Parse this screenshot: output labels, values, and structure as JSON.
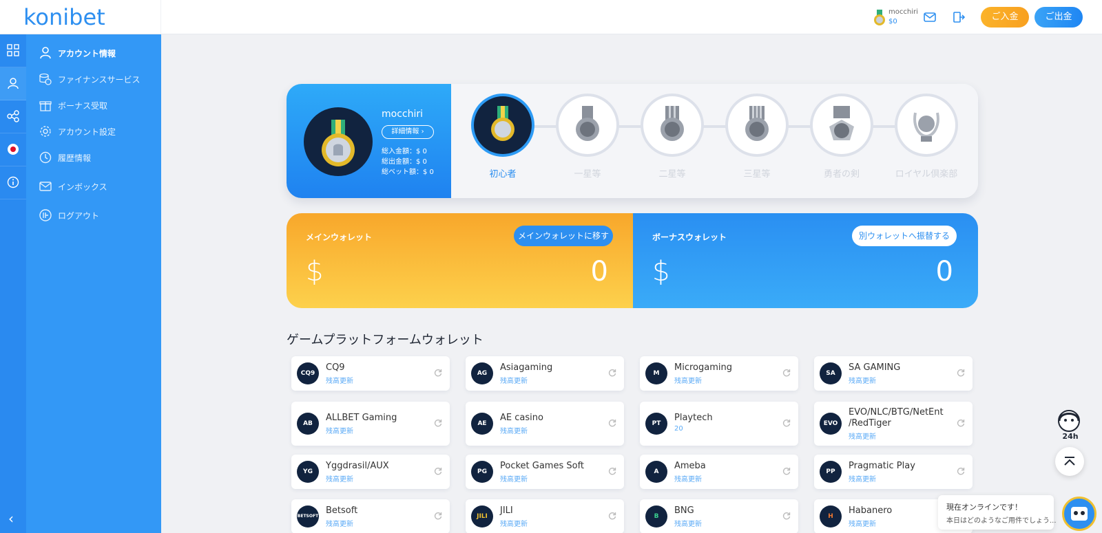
{
  "header": {
    "logo": "konibet",
    "username": "mocchiri",
    "balance": "$0",
    "deposit_label": "ご入金",
    "withdraw_label": "ご出金",
    "accent": "#2d8ff0"
  },
  "rail": {
    "icons": [
      "grid-icon",
      "user-icon",
      "share-icon",
      "flag-icon",
      "info-icon"
    ],
    "collapse": "‹"
  },
  "sidebar": {
    "items": [
      {
        "label": "アカウント情報",
        "icon": "user-icon"
      },
      {
        "label": "ファイナンスサービス",
        "icon": "finance-icon"
      },
      {
        "label": "ボーナス受取",
        "icon": "gift-icon"
      },
      {
        "label": "アカウント設定",
        "icon": "gear-icon"
      },
      {
        "label": "履歴情報",
        "icon": "history-icon"
      },
      {
        "label": "インボックス",
        "icon": "mail-icon"
      },
      {
        "label": "ログアウト",
        "icon": "logout-icon"
      }
    ]
  },
  "profile": {
    "name": "mocchiri",
    "detail_button": "詳細情報 ›",
    "stats": [
      "総入金額：$ 0",
      "総出金額：$ 0",
      "総ベット額：$ 0"
    ]
  },
  "levels": [
    "初心者",
    "一星等",
    "二星等",
    "三星等",
    "勇者の剣",
    "ロイヤル倶楽部"
  ],
  "wallets": {
    "main": {
      "title": "メインウォレット",
      "button": "メインウォレットに移す",
      "currency": "$",
      "value": "0"
    },
    "bonus": {
      "title": "ボーナスウォレット",
      "button": "別ウォレットへ振替する",
      "currency": "$",
      "value": "0"
    }
  },
  "platform_section_title": "ゲームプラットフォームウォレット",
  "platforms": [
    {
      "name": "CQ9",
      "balance": "残高更新",
      "logo": "CQ9"
    },
    {
      "name": "Asiagaming",
      "balance": "残高更新",
      "logo": "AG"
    },
    {
      "name": "Microgaming",
      "balance": "残高更新",
      "logo": "M"
    },
    {
      "name": "SA GAMING",
      "balance": "残高更新",
      "logo": "SA"
    },
    {
      "name": "ALLBET Gaming",
      "balance": "残高更新",
      "logo": "AB"
    },
    {
      "name": "AE casino",
      "balance": "残高更新",
      "logo": "AE"
    },
    {
      "name": "Playtech",
      "balance": "20",
      "logo": "PT"
    },
    {
      "name": "EVO/NLC/BTG/NetEnt",
      "name2": "/RedTiger",
      "balance": "残高更新",
      "logo": "EVO"
    },
    {
      "name": "Yggdrasil/AUX",
      "balance": "残高更新",
      "logo": "YG"
    },
    {
      "name": "Pocket Games Soft",
      "balance": "残高更新",
      "logo": "PG"
    },
    {
      "name": "Ameba",
      "balance": "残高更新",
      "logo": "A"
    },
    {
      "name": "Pragmatic Play",
      "balance": "残高更新",
      "logo": "PP"
    },
    {
      "name": "Betsoft",
      "balance": "残高更新",
      "logo": "BETSOFT"
    },
    {
      "name": "JILI",
      "balance": "残高更新",
      "logo": "JILI"
    },
    {
      "name": "BNG",
      "balance": "残高更新",
      "logo": "B"
    },
    {
      "name": "Habanero",
      "balance": "残高更新",
      "logo": "H"
    }
  ],
  "support": {
    "badge": "24h"
  },
  "chat": {
    "line1": "現在オンラインです！",
    "line2": "本日はどのようなご用件でしょう..."
  }
}
